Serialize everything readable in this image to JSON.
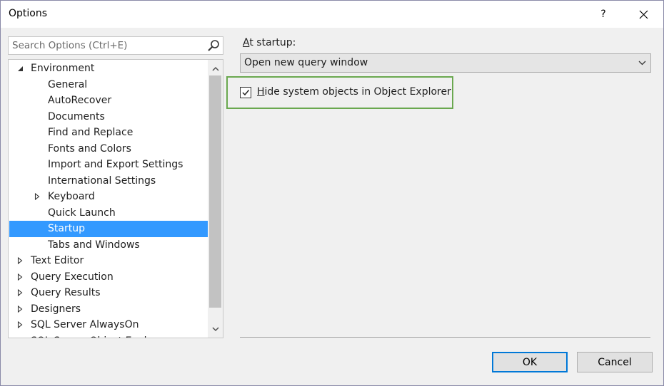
{
  "window": {
    "title": "Options",
    "help_label": "?"
  },
  "search": {
    "placeholder": "Search Options (Ctrl+E)"
  },
  "tree": {
    "items": [
      {
        "label": "Environment",
        "level": 0,
        "expander": "expanded",
        "selected": false
      },
      {
        "label": "General",
        "level": 1,
        "expander": "none",
        "selected": false
      },
      {
        "label": "AutoRecover",
        "level": 1,
        "expander": "none",
        "selected": false
      },
      {
        "label": "Documents",
        "level": 1,
        "expander": "none",
        "selected": false
      },
      {
        "label": "Find and Replace",
        "level": 1,
        "expander": "none",
        "selected": false
      },
      {
        "label": "Fonts and Colors",
        "level": 1,
        "expander": "none",
        "selected": false
      },
      {
        "label": "Import and Export Settings",
        "level": 1,
        "expander": "none",
        "selected": false
      },
      {
        "label": "International Settings",
        "level": 1,
        "expander": "none",
        "selected": false
      },
      {
        "label": "Keyboard",
        "level": 1,
        "expander": "collapsed",
        "selected": false
      },
      {
        "label": "Quick Launch",
        "level": 1,
        "expander": "none",
        "selected": false
      },
      {
        "label": "Startup",
        "level": 1,
        "expander": "none",
        "selected": true
      },
      {
        "label": "Tabs and Windows",
        "level": 1,
        "expander": "none",
        "selected": false
      },
      {
        "label": "Text Editor",
        "level": 0,
        "expander": "collapsed",
        "selected": false
      },
      {
        "label": "Query Execution",
        "level": 0,
        "expander": "collapsed",
        "selected": false
      },
      {
        "label": "Query Results",
        "level": 0,
        "expander": "collapsed",
        "selected": false
      },
      {
        "label": "Designers",
        "level": 0,
        "expander": "collapsed",
        "selected": false
      },
      {
        "label": "SQL Server AlwaysOn",
        "level": 0,
        "expander": "collapsed",
        "selected": false
      },
      {
        "label": "SQL Server Object Explorer",
        "level": 0,
        "expander": "collapsed",
        "selected": false
      }
    ]
  },
  "startup": {
    "at_startup_label_accesskey": "A",
    "at_startup_label_rest": "t startup:",
    "dropdown_value": "Open new query window",
    "checkbox_label_accesskey": "H",
    "checkbox_label_rest": "ide system objects in Object Explorer",
    "checkbox_checked": true
  },
  "buttons": {
    "ok": "OK",
    "cancel": "Cancel"
  },
  "colors": {
    "selection": "#3399ff",
    "highlight_box": "#6aa84f",
    "default_button_border": "#0078d7"
  },
  "icons": {
    "search": "search-icon",
    "close": "close-icon",
    "scroll_up": "chevron-up-icon",
    "scroll_down": "chevron-down-icon",
    "dropdown": "chevron-down-icon",
    "tree_expanded": "triangle-expanded-icon",
    "tree_collapsed": "triangle-collapsed-icon",
    "checkbox": "checkmark-icon"
  }
}
